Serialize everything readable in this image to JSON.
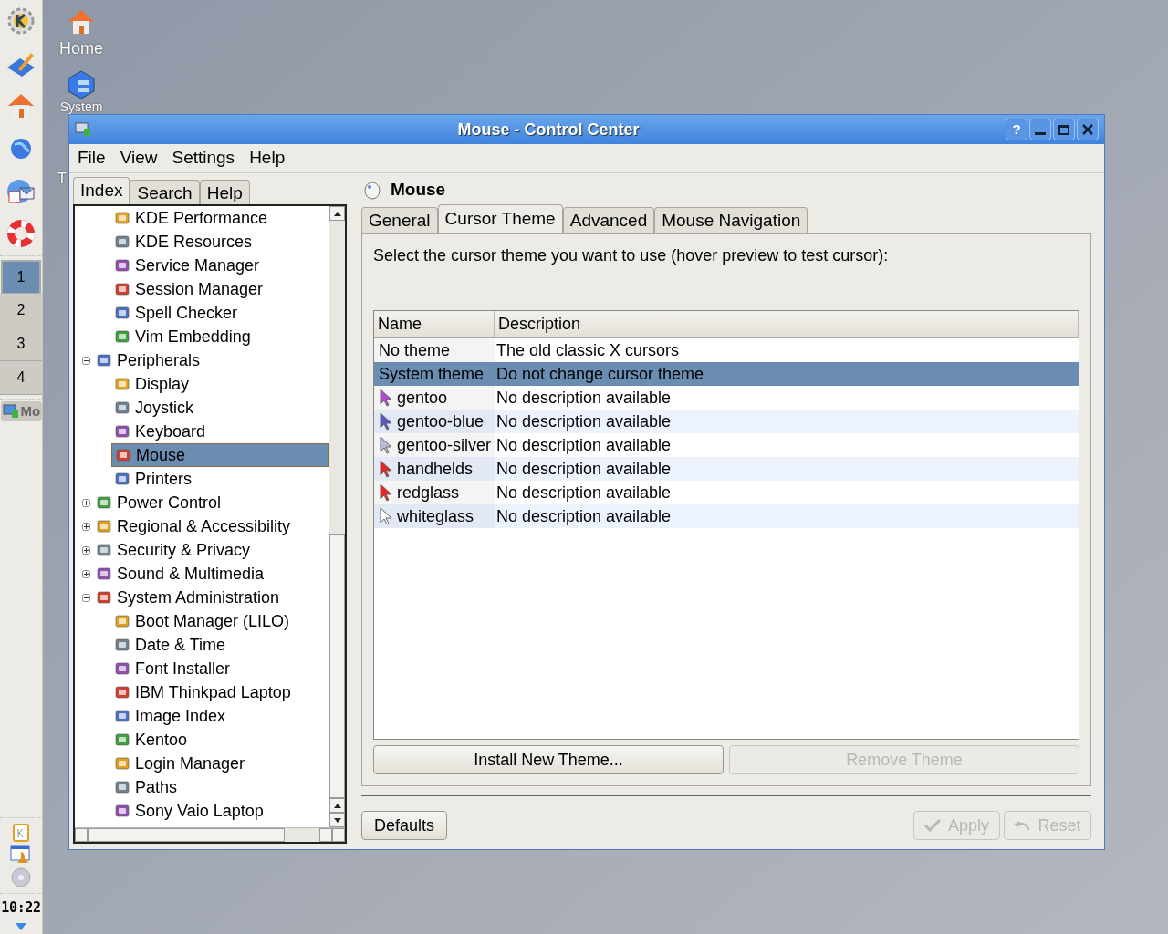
{
  "desktop_icons": [
    {
      "label": "Home"
    },
    {
      "label": "System"
    },
    {
      "label": "T"
    }
  ],
  "panel": {
    "pager": [
      {
        "label": "1",
        "selected": true
      },
      {
        "label": "2",
        "selected": false
      },
      {
        "label": "3",
        "selected": false
      },
      {
        "label": "4",
        "selected": false
      }
    ],
    "taskbar": [
      {
        "label": "Mo"
      }
    ],
    "clock": "10:22"
  },
  "window": {
    "title": "Mouse - Control Center",
    "help_button": "?",
    "menu": [
      "File",
      "View",
      "Settings",
      "Help"
    ],
    "left_tabs": [
      {
        "label": "Index",
        "selected": true
      },
      {
        "label": "Search",
        "selected": false
      },
      {
        "label": "Help",
        "selected": false
      }
    ],
    "tree": [
      {
        "children": [
          {
            "label": "KDE Performance",
            "selected": false
          },
          {
            "label": "KDE Resources",
            "selected": false
          },
          {
            "label": "Service Manager",
            "selected": false
          },
          {
            "label": "Session Manager",
            "selected": false
          },
          {
            "label": "Spell Checker",
            "selected": false
          },
          {
            "label": "Vim Embedding",
            "selected": false
          }
        ]
      },
      {
        "label": "Peripherals",
        "selected": false,
        "expanded": true,
        "children": [
          {
            "label": "Display",
            "selected": false
          },
          {
            "label": "Joystick",
            "selected": false
          },
          {
            "label": "Keyboard",
            "selected": false
          },
          {
            "label": "Mouse",
            "selected": true
          },
          {
            "label": "Printers",
            "selected": false
          }
        ]
      },
      {
        "label": "Power Control",
        "selected": false,
        "expanded": false
      },
      {
        "label": "Regional & Accessibility",
        "selected": false,
        "expanded": false
      },
      {
        "label": "Security & Privacy",
        "selected": false,
        "expanded": false
      },
      {
        "label": "Sound & Multimedia",
        "selected": false,
        "expanded": false
      },
      {
        "label": "System Administration",
        "selected": false,
        "expanded": true,
        "children": [
          {
            "label": "Boot Manager (LILO)",
            "selected": false
          },
          {
            "label": "Date & Time",
            "selected": false
          },
          {
            "label": "Font Installer",
            "selected": false
          },
          {
            "label": "IBM Thinkpad Laptop",
            "selected": false
          },
          {
            "label": "Image Index",
            "selected": false
          },
          {
            "label": "Kentoo",
            "selected": false
          },
          {
            "label": "Login Manager",
            "selected": false
          },
          {
            "label": "Paths",
            "selected": false
          },
          {
            "label": "Sony Vaio Laptop",
            "selected": false
          }
        ]
      }
    ],
    "module_title": "Mouse",
    "tabs": [
      {
        "label": "General",
        "selected": false
      },
      {
        "label": "Cursor Theme",
        "selected": true
      },
      {
        "label": "Advanced",
        "selected": false
      },
      {
        "label": "Mouse Navigation",
        "selected": false
      }
    ],
    "instruction": "Select the cursor theme you want to use (hover preview to test cursor):",
    "table": {
      "columns": [
        "Name",
        "Description"
      ],
      "rows": [
        {
          "name": "No theme",
          "description": "The old classic X cursors",
          "selected": false
        },
        {
          "name": "System theme",
          "description": "Do not change cursor theme",
          "selected": true
        },
        {
          "name": "gentoo",
          "description": "No description available",
          "selected": false,
          "color": "#b04ad0"
        },
        {
          "name": "gentoo-blue",
          "description": "No description available",
          "selected": false,
          "color": "#5a58c0"
        },
        {
          "name": "gentoo-silver",
          "description": "No description available",
          "selected": false,
          "color": "#b8bcdc"
        },
        {
          "name": "handhelds",
          "description": "No description available",
          "selected": false,
          "color": "#e02828"
        },
        {
          "name": "redglass",
          "description": "No description available",
          "selected": false,
          "color": "#f02020"
        },
        {
          "name": "whiteglass",
          "description": "No description available",
          "selected": false,
          "color": "#ffffff"
        }
      ]
    },
    "theme_buttons": [
      {
        "label": "Install New Theme...",
        "disabled": false
      },
      {
        "label": "Remove Theme",
        "disabled": true
      }
    ],
    "defaults_button": {
      "label": "Defaults",
      "disabled": false
    },
    "action_buttons": [
      {
        "label": "Apply",
        "disabled": true
      },
      {
        "label": "Reset",
        "disabled": true
      }
    ]
  }
}
